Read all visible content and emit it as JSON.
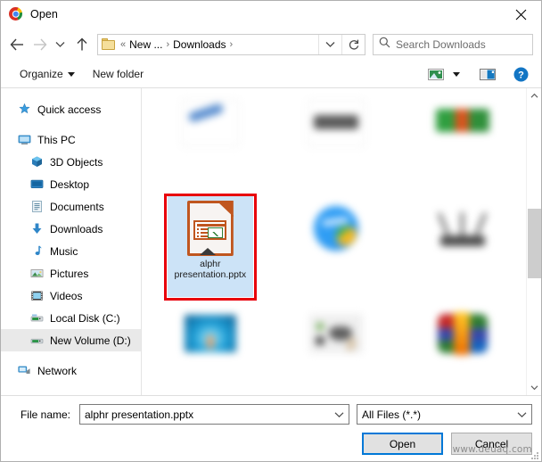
{
  "window": {
    "title": "Open",
    "app_icon": "chrome-logo-icon",
    "close_label": "✕"
  },
  "nav": {
    "back": "back-arrow-icon",
    "forward": "forward-arrow-icon",
    "recent": "chevron-down-icon",
    "up": "up-arrow-icon"
  },
  "address": {
    "folder_icon": "folder-icon",
    "overflow": "«",
    "crumbs": [
      "New ...",
      "Downloads"
    ],
    "separator": "›",
    "dropdown_icon": "chevron-down-icon",
    "refresh_icon": "refresh-icon"
  },
  "search": {
    "placeholder": "Search Downloads",
    "icon": "search-icon"
  },
  "command_bar": {
    "organize": "Organize",
    "new_folder": "New folder",
    "view_icon": "view-layout-icon",
    "view_dropdown_icon": "chevron-down-icon",
    "preview_pane_icon": "preview-pane-icon",
    "help_icon": "help-icon"
  },
  "sidebar": {
    "items": [
      {
        "label": "Quick access",
        "icon": "star-pin-icon",
        "indent": false,
        "selected": false,
        "gap_after": true
      },
      {
        "label": "This PC",
        "icon": "monitor-icon",
        "indent": false,
        "selected": false,
        "gap_after": false
      },
      {
        "label": "3D Objects",
        "icon": "cube-icon",
        "indent": true,
        "selected": false,
        "gap_after": false
      },
      {
        "label": "Desktop",
        "icon": "desktop-icon",
        "indent": true,
        "selected": false,
        "gap_after": false
      },
      {
        "label": "Documents",
        "icon": "document-icon",
        "indent": true,
        "selected": false,
        "gap_after": false
      },
      {
        "label": "Downloads",
        "icon": "download-arrow-icon",
        "indent": true,
        "selected": false,
        "gap_after": false
      },
      {
        "label": "Music",
        "icon": "music-note-icon",
        "indent": true,
        "selected": false,
        "gap_after": false
      },
      {
        "label": "Pictures",
        "icon": "picture-icon",
        "indent": true,
        "selected": false,
        "gap_after": false
      },
      {
        "label": "Videos",
        "icon": "video-icon",
        "indent": true,
        "selected": false,
        "gap_after": false
      },
      {
        "label": "Local Disk (C:)",
        "icon": "hard-drive-icon",
        "indent": true,
        "selected": false,
        "gap_after": false
      },
      {
        "label": "New Volume (D:)",
        "icon": "hard-drive-icon",
        "indent": true,
        "selected": true,
        "gap_after": true
      },
      {
        "label": "Network",
        "icon": "network-icon",
        "indent": false,
        "selected": false,
        "gap_after": false
      }
    ]
  },
  "files": {
    "items": [
      {
        "name": "",
        "icon": "blurred-image-thumbnail",
        "selected": false,
        "censored": true,
        "art": "swoosh"
      },
      {
        "name": "",
        "icon": "blurred-image-thumbnail",
        "selected": false,
        "censored": true,
        "art": "barblk"
      },
      {
        "name": "",
        "icon": "blurred-image-thumbnail",
        "selected": false,
        "censored": true,
        "art": "greenband"
      },
      {
        "name": "alphr presentation.pptx",
        "icon": "impress-presentation-icon",
        "selected": true,
        "censored": false,
        "art": "impress"
      },
      {
        "name": "",
        "icon": "blurred-globe-thumbnail",
        "selected": false,
        "censored": true,
        "art": "globe"
      },
      {
        "name": "",
        "icon": "blurred-router-thumbnail",
        "selected": false,
        "censored": true,
        "art": "router"
      },
      {
        "name": "",
        "icon": "blurred-image-thumbnail",
        "selected": false,
        "censored": true,
        "art": "bluepic"
      },
      {
        "name": "",
        "icon": "blurred-image-thumbnail",
        "selected": false,
        "censored": true,
        "art": "graypic"
      },
      {
        "name": "",
        "icon": "blurred-archive-thumbnail",
        "selected": false,
        "censored": true,
        "art": "rar"
      }
    ],
    "highlight_color": "#e8000b",
    "selection_color": "#cce3f7"
  },
  "scrollbar": {
    "up_icon": "chevron-up-icon",
    "down_icon": "chevron-down-icon"
  },
  "footer": {
    "file_name_label": "File name:",
    "file_name_value": "alphr presentation.pptx",
    "file_type_value": "All Files (*.*)",
    "open_label": "Open",
    "cancel_label": "Cancel",
    "dropdown_icon": "chevron-down-icon",
    "accent_color": "#0078d7"
  },
  "watermark": {
    "text": "www.deuaq.com"
  }
}
